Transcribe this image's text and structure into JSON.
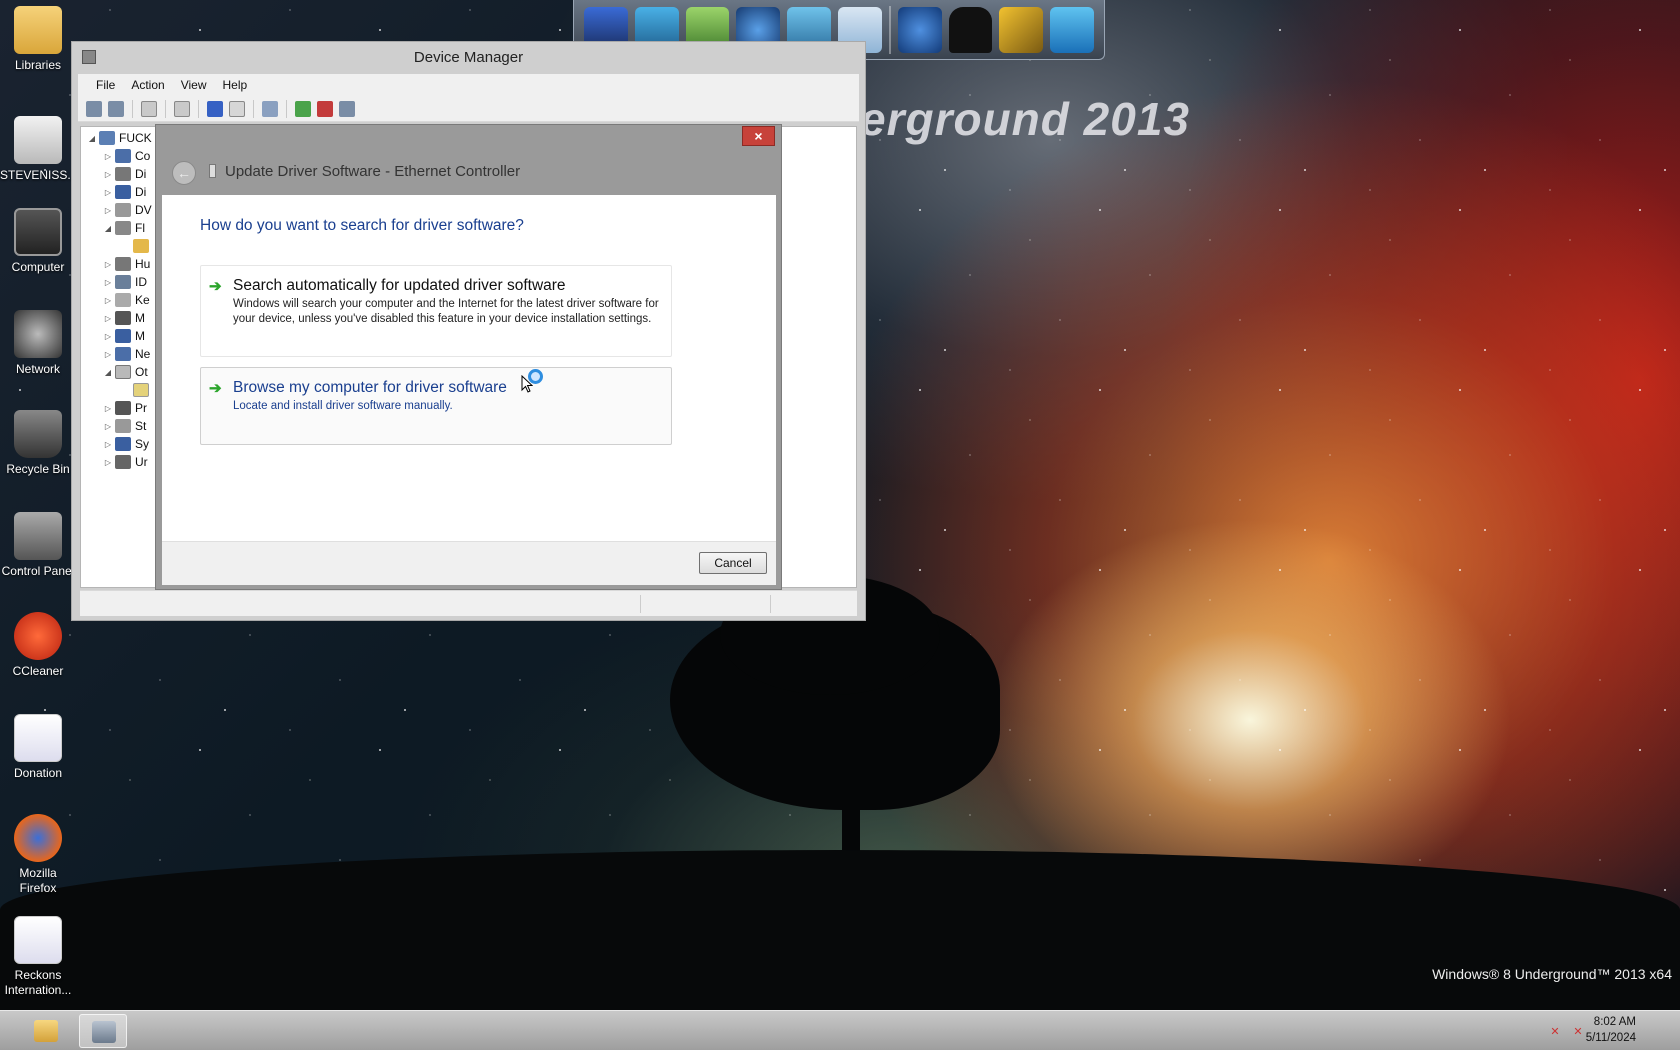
{
  "desktop": {
    "wallpaper_title": "erground 2013",
    "watermark": "Windows® 8 Underground™ 2013 x64",
    "icons": [
      {
        "label": "Libraries"
      },
      {
        "label": "STEVENISS..."
      },
      {
        "label": "Computer"
      },
      {
        "label": "Network"
      },
      {
        "label": "Recycle Bin"
      },
      {
        "label": "Control Panel"
      },
      {
        "label": "CCleaner"
      },
      {
        "label": "Donation"
      },
      {
        "label": "Mozilla Firefox"
      },
      {
        "label": "Reckons Internation..."
      }
    ]
  },
  "dock": {
    "items": [
      "monitor-icon",
      "network-computers-icon",
      "library-books-icon",
      "media-player-icon",
      "folder-pictures-icon",
      "disc-icon",
      "network-globe-icon",
      "tshirt-icon",
      "tools-icon",
      "recycle-bin-icon"
    ]
  },
  "device_manager": {
    "title": "Device Manager",
    "menu": [
      "File",
      "Action",
      "View",
      "Help"
    ],
    "tree": {
      "root": "FUCK",
      "items": [
        "Co",
        "Di",
        "Di",
        "DV",
        "Fl",
        "",
        "Hu",
        "ID",
        "Ke",
        "M",
        "M",
        "Ne",
        "Ot",
        "",
        "Pr",
        "St",
        "Sy",
        "Ur"
      ]
    }
  },
  "dialog": {
    "title": "Update Driver Software - Ethernet Controller",
    "close_label": "×",
    "back_label": "←",
    "question": "How do you want to search for driver software?",
    "option_auto": {
      "arrow": "➔",
      "title": "Search automatically for updated driver software",
      "description": "Windows will search your computer and the Internet for the latest driver software for your device, unless you've disabled this feature in your device installation settings."
    },
    "option_browse": {
      "arrow": "➔",
      "title": "Browse my computer for driver software",
      "description": "Locate and install driver software manually."
    },
    "cancel_label": "Cancel"
  },
  "taskbar": {
    "apps": [
      "file-explorer-icon",
      "device-manager-icon"
    ],
    "tray": [
      "network-disconnected-icon",
      "volume-muted-icon"
    ],
    "time": "8:02 AM",
    "date": "5/11/2024"
  },
  "colors": {
    "link_blue": "#1a3f8f",
    "arrow_green": "#2ca52c",
    "close_red": "#c7423a"
  }
}
